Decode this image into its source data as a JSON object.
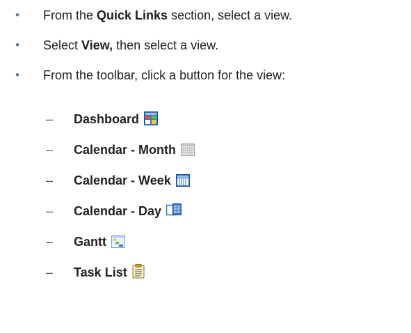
{
  "bullets": [
    {
      "before": "From the ",
      "bold": "Quick Links",
      "after": " section, select a view."
    },
    {
      "before": "Select ",
      "bold": "View,",
      "after": " then select a view."
    },
    {
      "before": "From the toolbar, click a button for the view:",
      "bold": "",
      "after": ""
    }
  ],
  "bullet_marker": "•",
  "dash_marker": "–",
  "views": [
    {
      "label": "Dashboard",
      "icon": "dashboard-icon"
    },
    {
      "label": "Calendar - Month",
      "icon": "calendar-month-icon"
    },
    {
      "label": "Calendar - Week",
      "icon": "calendar-week-icon"
    },
    {
      "label": "Calendar - Day",
      "icon": "calendar-day-icon"
    },
    {
      "label": "Gantt",
      "icon": "gantt-icon"
    },
    {
      "label": "Task List",
      "icon": "task-list-icon"
    }
  ],
  "colors": {
    "bullet": "#5a7a92",
    "text": "#1f1f1f",
    "icon_blue": "#3a74c4"
  }
}
